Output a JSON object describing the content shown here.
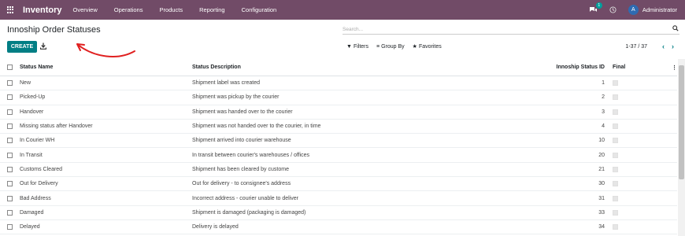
{
  "navbar": {
    "brand": "Inventory",
    "menu": [
      "Overview",
      "Operations",
      "Products",
      "Reporting",
      "Configuration"
    ],
    "chat_badge": "1",
    "avatar_letter": "A",
    "user_name": "Administrator",
    "bg_color": "#714B67"
  },
  "control_panel": {
    "title": "Innoship Order Statuses",
    "search_placeholder": "Search...",
    "create_label": "CREATE",
    "filters_label": "Filters",
    "groupby_label": "Group By",
    "favorites_label": "Favorites",
    "pager_value": "1-37 / 37"
  },
  "table": {
    "headers": {
      "name": "Status Name",
      "description": "Status Description",
      "id": "Innoship Status ID",
      "final": "Final"
    },
    "rows": [
      {
        "name": "New",
        "description": "Shipment label was created",
        "id": "1"
      },
      {
        "name": "Picked-Up",
        "description": "Shipment was pickup by the courier",
        "id": "2"
      },
      {
        "name": "Handover",
        "description": "Shipment was handed over to the courier",
        "id": "3"
      },
      {
        "name": "Missing status after Handover",
        "description": "Shipment was not handed over to the courier, in time",
        "id": "4"
      },
      {
        "name": "In Courier WH",
        "description": "Shipment arrived into courier warehouse",
        "id": "10"
      },
      {
        "name": "In Transit",
        "description": "In transit between courier's warehouses / offices",
        "id": "20"
      },
      {
        "name": "Customs Cleared",
        "description": "Shipment has been cleared by custome",
        "id": "21"
      },
      {
        "name": "Out for Delivery",
        "description": "Out for delivery - to consignee's address",
        "id": "30"
      },
      {
        "name": "Bad Address",
        "description": "Incorrect address - courier unable to deliver",
        "id": "31"
      },
      {
        "name": "Damaged",
        "description": "Shipment is damaged (packaging is damaged)",
        "id": "33"
      },
      {
        "name": "Delayed",
        "description": "Delivery is delayed",
        "id": "34"
      }
    ]
  },
  "colors": {
    "accent": "#017E84",
    "arrow": "#E02020"
  }
}
